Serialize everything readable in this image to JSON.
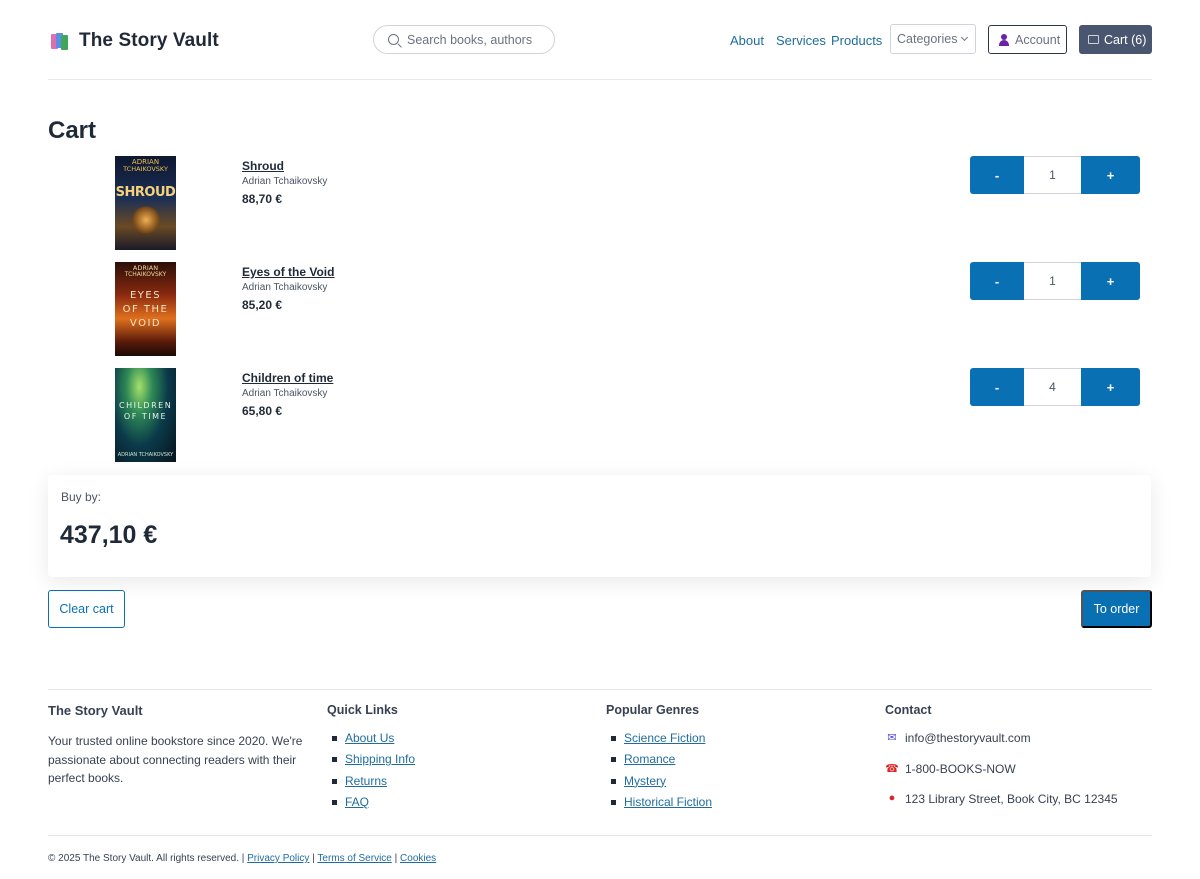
{
  "header": {
    "site_title": "The Story Vault",
    "search_placeholder": "Search books, authors",
    "nav": [
      "About",
      "Services",
      "Products"
    ],
    "categories_label": "Categories",
    "account_label": "Account",
    "cart_label": "Cart (6)"
  },
  "cart": {
    "title": "Cart",
    "items": [
      {
        "title": "Shroud",
        "author": "Adrian Tchaikovsky",
        "price": "88,70 €",
        "quantity": "1",
        "cover": {
          "author_line1": "ADRIAN",
          "author_line2": "TCHAIKOVSKY",
          "title_text": "SHROUD"
        }
      },
      {
        "title": "Eyes of the Void",
        "author": "Adrian Tchaikovsky",
        "price": "85,20 €",
        "quantity": "1",
        "cover": {
          "author_line1": "ADRIAN",
          "author_line2": "TCHAIKOVSKY",
          "title_text": "EYES OF THE VOID"
        }
      },
      {
        "title": "Children of time",
        "author": "Adrian Tchaikovsky",
        "price": "65,80 €",
        "quantity": "4",
        "cover": {
          "author_line1": "ADRIAN TCHAIKOVSKY",
          "author_line2": "",
          "title_text": "CHILDREN OF TIME"
        }
      }
    ],
    "minus_label": "-",
    "plus_label": "+",
    "buy_by_label": "Buy by:",
    "total": "437,10 €",
    "clear_label": "Clear cart",
    "order_label": "To order"
  },
  "footer": {
    "about": {
      "heading": "The Story Vault",
      "text": "Your trusted online bookstore since 2020. We're passionate about connecting readers with their perfect books."
    },
    "quick_links": {
      "heading": "Quick Links",
      "items": [
        "About Us",
        "Shipping Info",
        "Returns",
        "FAQ"
      ]
    },
    "genres": {
      "heading": "Popular Genres",
      "items": [
        "Science Fiction",
        "Romance",
        "Mystery",
        "Historical Fiction"
      ]
    },
    "contact": {
      "heading": "Contact",
      "email": "info@thestoryvault.com",
      "phone": "1-800-BOOKS-NOW",
      "address": "123 Library Street, Book City, BC 12345"
    },
    "copyright": "© 2025 The Story Vault. All rights reserved. |",
    "privacy": "Privacy Policy",
    "terms": "Terms of Service",
    "cookies": "Cookies",
    "separator": "|"
  },
  "icons": {
    "logo": "books-icon",
    "search": "search-icon",
    "account": "user-icon",
    "cart": "cart-icon",
    "email": "email-icon",
    "phone": "phone-icon",
    "address": "pin-icon"
  },
  "colors": {
    "primary": "#0a70b4",
    "link": "#1f6d9e",
    "cart_button": "#4a5670",
    "heading": "#1f2937"
  }
}
